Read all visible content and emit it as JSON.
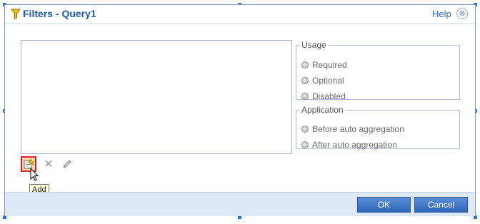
{
  "dialog": {
    "title": "Filters - Query1",
    "help_label": "Help",
    "close_glyph": "⊗"
  },
  "usage": {
    "legend": "Usage",
    "options": [
      {
        "label": "Required",
        "selected": false
      },
      {
        "label": "Optional",
        "selected": false
      },
      {
        "label": "Disabled",
        "selected": false
      }
    ]
  },
  "application": {
    "legend": "Application",
    "options": [
      {
        "label": "Before auto aggregation",
        "selected": false
      },
      {
        "label": "After auto aggregation",
        "selected": false
      }
    ]
  },
  "toolbar": {
    "add_tooltip": "Add",
    "delete_glyph": "✕"
  },
  "footer": {
    "ok_label": "OK",
    "cancel_label": "Cancel"
  },
  "colors": {
    "title": "#1d5ba4",
    "accent_button": "#2f66b8",
    "highlight_border": "#d7262e"
  }
}
